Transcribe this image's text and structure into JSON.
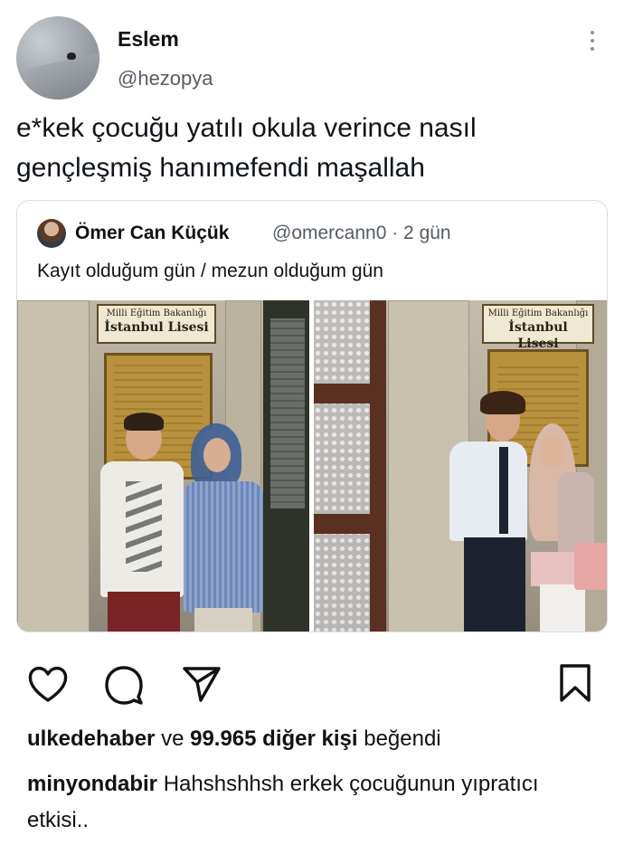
{
  "tweet": {
    "author_name": "Eslem",
    "author_handle": "@hezopya",
    "text": "e*kek çocuğu yatılı okula verince nasıl gençleşmiş hanımefendi maşallah"
  },
  "quoted_tweet": {
    "author_name": "Ömer Can Küçük",
    "author_handle": "@omercann0",
    "time": "· 2 gün",
    "text": "Kayıt olduğum gün / mezun olduğum gün",
    "photo_left_sign": {
      "line1": "Milli Eğitim Bakanlığı",
      "line2": "İstanbul Lisesi"
    },
    "photo_right_sign": {
      "line1": "Milli Eğitim Bakanlığı",
      "line2": "İstanbul Lisesi"
    }
  },
  "post": {
    "actions": [
      "heart-icon",
      "comment-icon",
      "share-icon",
      "bookmark-icon"
    ],
    "likes": {
      "user": "ulkedehaber",
      "connector": "ve",
      "count": "99.965 diğer kişi",
      "suffix": "beğendi"
    },
    "caption": {
      "user": "minyondabir",
      "text": "Hahshshhsh erkek çocuğunun yıpratıcı etkisi.."
    }
  }
}
